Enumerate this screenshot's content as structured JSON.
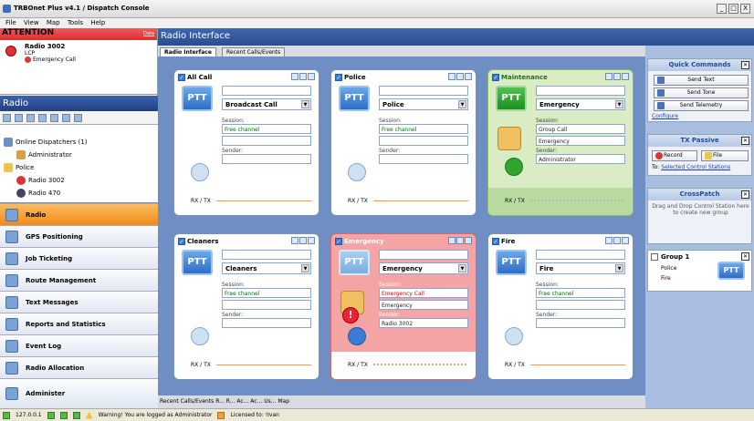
{
  "window": {
    "title": "TRBOnet Plus v4.1 / Dispatch Console",
    "controls": [
      "_",
      "□",
      "X"
    ]
  },
  "menu": [
    "File",
    "View",
    "Map",
    "Tools",
    "Help"
  ],
  "attention": {
    "title": "ATTENTION",
    "link": "Data",
    "radio": "Radio 3002",
    "sub": "LCP",
    "event": "Emergency Call"
  },
  "radio_panel": {
    "title": "Radio",
    "tree": [
      {
        "label": "Online Dispatchers (1)"
      },
      {
        "label": "Administrator"
      },
      {
        "label": "Police"
      },
      {
        "label": "Radio 3002"
      },
      {
        "label": "Radio 470"
      }
    ]
  },
  "nav": [
    "Radio",
    "GPS Positioning",
    "Job Ticketing",
    "Route Management",
    "Text Messages",
    "Reports and Statistics",
    "Event Log",
    "Radio Allocation",
    "Administer"
  ],
  "main": {
    "title": "Radio Interface",
    "tabs": [
      "Radio Interface",
      "Recent Calls/Events"
    ]
  },
  "cards": [
    {
      "name": "All Call",
      "ptt": "PTT",
      "select": "Broadcast Call",
      "session_label": "Session:",
      "session": "Free channel",
      "extra": "",
      "sender_label": "Sender:",
      "sender": "",
      "rxtx": "RX / TX"
    },
    {
      "name": "Police",
      "ptt": "PTT",
      "select": "Police",
      "session_label": "Session:",
      "session": "Free channel",
      "extra": "",
      "sender_label": "Sender:",
      "sender": "",
      "rxtx": "RX / TX"
    },
    {
      "name": "Maintenance",
      "ptt": "PTT",
      "select": "Emergency",
      "session_label": "Session:",
      "session": "Group Call",
      "extra": "Emergency",
      "sender_label": "Sender:",
      "sender": "Administrator",
      "rxtx": "RX / TX"
    },
    {
      "name": "Cleaners",
      "ptt": "PTT",
      "select": "Cleaners",
      "session_label": "Session:",
      "session": "Free channel",
      "extra": "",
      "sender_label": "Sender:",
      "sender": "",
      "rxtx": "RX / TX"
    },
    {
      "name": "Emergency",
      "ptt": "PTT",
      "select": "Emergency",
      "session_label": "Session:",
      "session": "Emergency Call",
      "extra": "Emergency",
      "sender_label": "Sender:",
      "sender": "Radio 3002",
      "rxtx": "RX / TX"
    },
    {
      "name": "Fire",
      "ptt": "PTT",
      "select": "Fire",
      "session_label": "Session:",
      "session": "Free channel",
      "extra": "",
      "sender_label": "Sender:",
      "sender": "",
      "rxtx": "RX / TX"
    }
  ],
  "bottom_tabs": "Recent Calls/Events  R...  R...  Ac...  Ac...  Us...  Map",
  "quick": {
    "title": "Quick Commands",
    "buttons": [
      "Send Text",
      "Send Tone",
      "Send Telemetry"
    ],
    "configure": "Configure"
  },
  "tx": {
    "title": "TX Passive",
    "record": "Record",
    "file": "File",
    "to_label": "To:",
    "to": "Selected Control Stations"
  },
  "cross": {
    "title": "CrossPatch",
    "hint": "Drag and Drop Control Station here to create new group"
  },
  "group": {
    "name": "Group 1",
    "members": [
      "Police",
      "Fire"
    ],
    "ptt": "PTT"
  },
  "status": {
    "ip": "127.0.0.1",
    "warning": "Warning! You are logged as Administrator",
    "license": "Licensed to: !Ivan"
  }
}
